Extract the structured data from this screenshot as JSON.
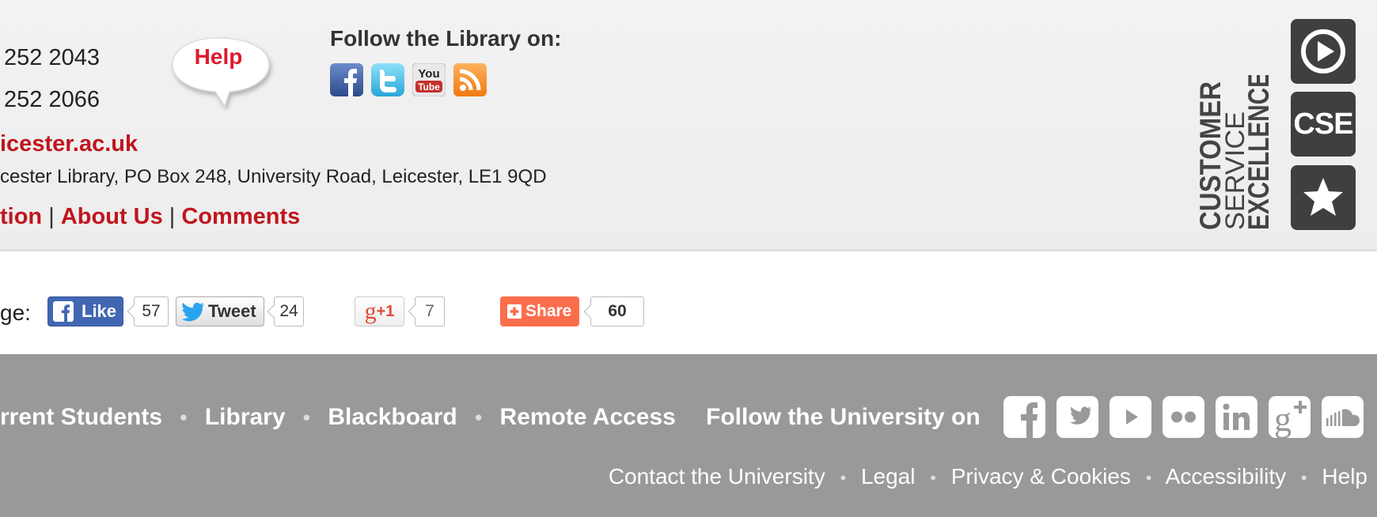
{
  "library": {
    "phone_1": "252 2043",
    "phone_2": "252 2066",
    "email": "icester.ac.uk",
    "address": "cester Library, PO Box 248, University Road, Leicester, LE1 9QD",
    "link_1": "tion",
    "link_2": "About Us",
    "link_3": "Comments",
    "separator": "|",
    "help_label": "Help",
    "follow_label": "Follow the Library on:",
    "social_icons": [
      "facebook-icon",
      "twitter-icon",
      "youtube-icon",
      "rss-icon"
    ],
    "youtube_top": "You",
    "youtube_bottom": "Tube"
  },
  "cse": {
    "line_1": "CUSTOMER",
    "line_2": "SERVICE",
    "line_3": "EXCELLENCE",
    "badge_text": "CSE",
    "icons": [
      "play-icon",
      "cse-icon",
      "star-icon"
    ]
  },
  "share": {
    "label": "ge:",
    "like_label": "Like",
    "like_count": "57",
    "tweet_label": "Tweet",
    "tweet_count": "24",
    "gplus_label": "+1",
    "gplus_count": "7",
    "share_label": "Share",
    "share_count": "60"
  },
  "university": {
    "nav": [
      "rrent Students",
      "Library",
      "Blackboard",
      "Remote Access"
    ],
    "follow_label": "Follow the University on",
    "social_icons": [
      "facebook-icon",
      "twitter-icon",
      "youtube-icon",
      "flickr-icon",
      "linkedin-icon",
      "googleplus-icon",
      "soundcloud-icon"
    ],
    "bottom_links": [
      "Contact the University",
      "Legal",
      "Privacy & Cookies",
      "Accessibility",
      "Help"
    ],
    "bullet": "•"
  },
  "colors": {
    "accent_red": "#c0161e",
    "footer_grey": "#999999",
    "facebook_blue": "#3b5998",
    "share_orange": "#fc6d4c"
  }
}
